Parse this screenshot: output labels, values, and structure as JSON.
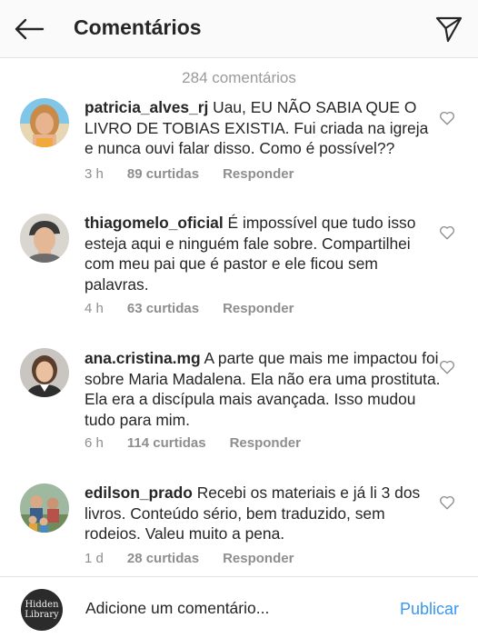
{
  "header": {
    "title": "Comentários",
    "back_icon": "back-arrow-icon",
    "send_icon": "paper-plane-icon"
  },
  "comment_count": "284 comentários",
  "comments": [
    {
      "username": "patricia_alves_rj",
      "text": " Uau, EU NÃO SABIA QUE O LIVRO DE TOBIAS EXISTIA. Fui criada na igreja e nunca ouvi falar disso. Como é possível??",
      "time": "3 h",
      "likes": "89 curtidas",
      "reply": "Responder"
    },
    {
      "username": "thiagomelo_oficial",
      "text": " É impossível que tudo isso esteja aqui e ninguém fale sobre. Compartilhei com meu pai que é pastor e ele ficou sem palavras.",
      "time": "4 h",
      "likes": "63 curtidas",
      "reply": "Responder"
    },
    {
      "username": "ana.cristina.mg",
      "text": " A parte que mais me impactou foi sobre Maria Madalena. Ela não era uma prostituta. Ela era a discípula mais avançada. Isso mudou tudo para mim.",
      "time": "6 h",
      "likes": "114 curtidas",
      "reply": "Responder"
    },
    {
      "username": "edilson_prado",
      "text": " Recebi os materiais e já li 3 dos livros. Conteúdo sério, bem traduzido, sem rodeios. Valeu muito a pena.",
      "time": "1 d",
      "likes": "28 curtidas",
      "reply": "Responder"
    }
  ],
  "footer": {
    "logo_line1": "Hidden",
    "logo_line2": "Library",
    "placeholder": "Adicione um comentário...",
    "publish_label": "Publicar"
  },
  "colors": {
    "link_blue": "#3897f0",
    "meta_gray": "#8e8e8e",
    "count_gray": "#9a9a9a"
  }
}
